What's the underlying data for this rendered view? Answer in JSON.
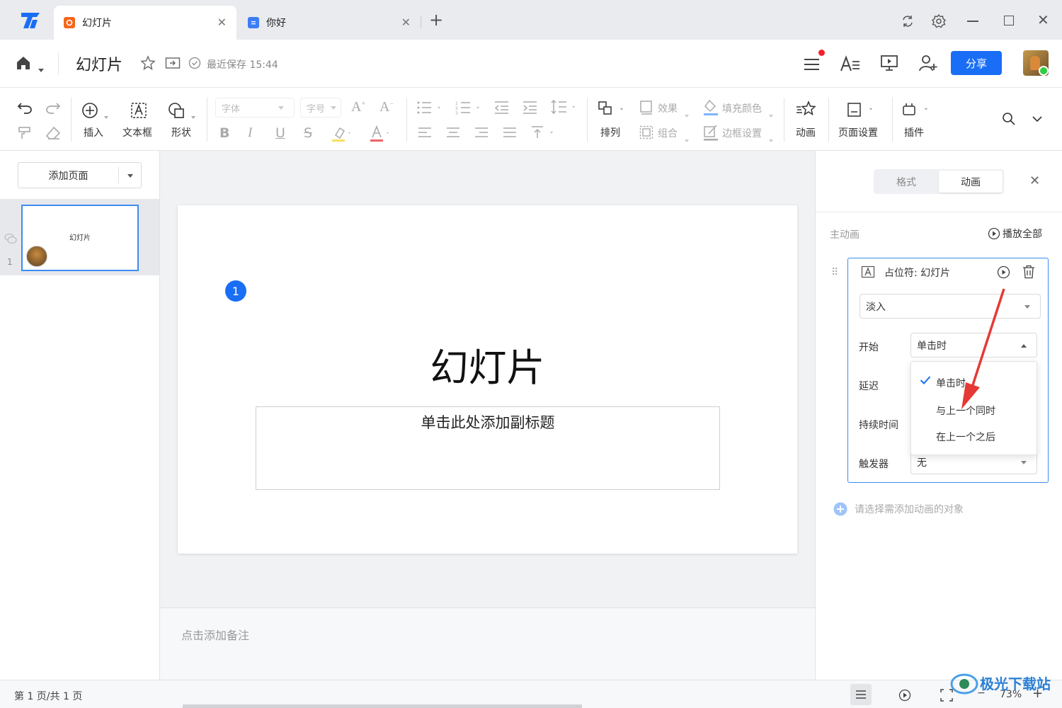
{
  "tabs": [
    {
      "label": "幻灯片",
      "active": true,
      "icon": "presentation-tab-icon",
      "color": "#f4661b"
    },
    {
      "label": "你好",
      "active": false,
      "icon": "document-tab-icon",
      "color": "#3c7cf6"
    }
  ],
  "header": {
    "title": "幻灯片",
    "save_status": "最近保存 15:44",
    "share_label": "分享"
  },
  "toolbar": {
    "insert": "插入",
    "textbox": "文本框",
    "shape": "形状",
    "font_placeholder": "字体",
    "size_placeholder": "字号",
    "arrange": "排列",
    "effect": "效果",
    "group": "组合",
    "fill_color": "填充颜色",
    "border": "边框设置",
    "animation": "动画",
    "page_setup": "页面设置",
    "plugin": "插件"
  },
  "leftpanel": {
    "add_page": "添加页面",
    "thumb_title": "幻灯片",
    "page_number": "1"
  },
  "slide": {
    "badge": "1",
    "title": "幻灯片",
    "subtitle_placeholder": "单击此处添加副标题"
  },
  "notes_placeholder": "点击添加备注",
  "rightpanel": {
    "tab_format": "格式",
    "tab_animation": "动画",
    "main_animation_label": "主动画",
    "play_all": "播放全部",
    "anim_item_title": "占位符: 幻灯片",
    "effect_value": "淡入",
    "start_label": "开始",
    "start_value": "单击时",
    "delay_label": "延迟",
    "duration_label": "持续时间",
    "trigger_label": "触发器",
    "trigger_value": "无",
    "dropdown_options": [
      "单击时",
      "与上一个同时",
      "在上一个之后"
    ],
    "selected_option": "单击时",
    "add_hint": "请选择需添加动画的对象"
  },
  "statusbar": {
    "page_info": "第 1 页/共 1 页",
    "zoom": "73%"
  },
  "watermark": "极光下载站",
  "colors": {
    "accent": "#1a6ef5",
    "arrow": "#e53935"
  }
}
